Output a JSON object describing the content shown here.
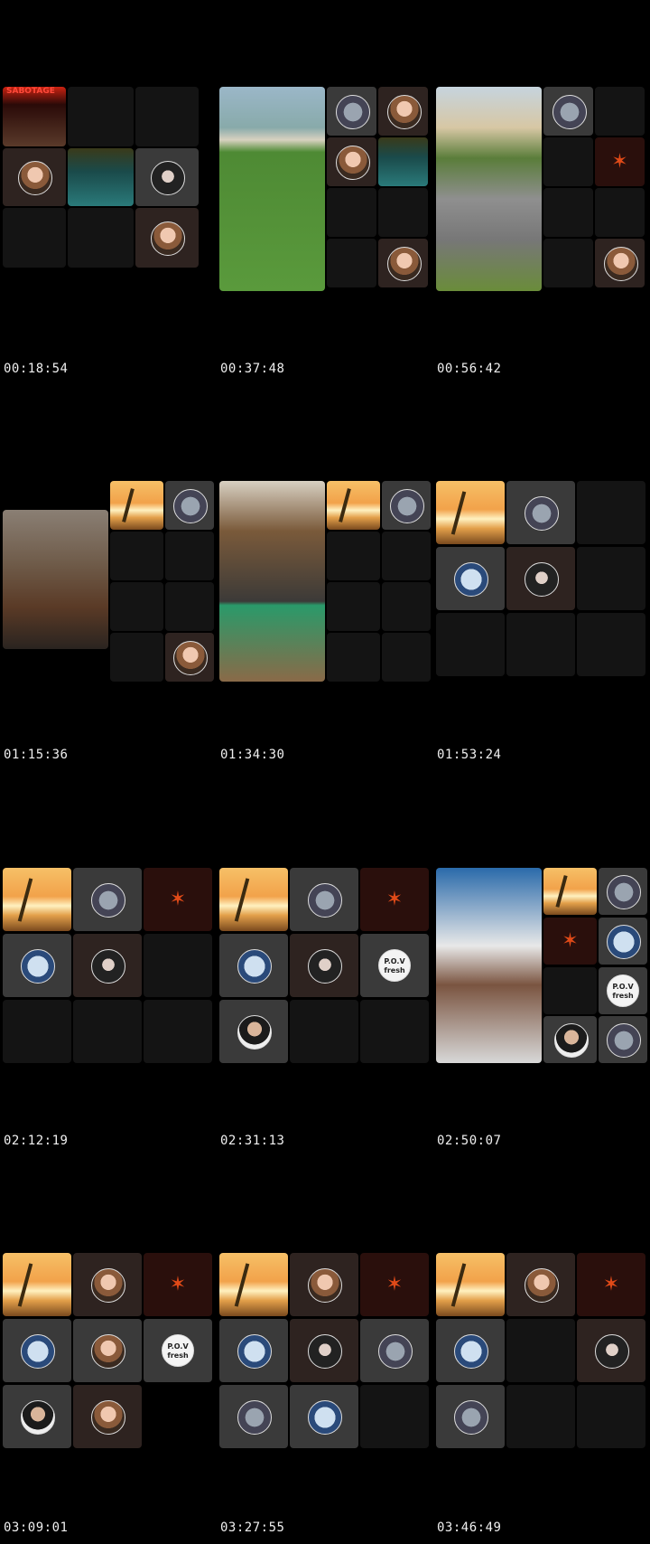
{
  "timestamps": [
    "00:18:54",
    "00:37:48",
    "00:56:42",
    "01:15:36",
    "01:34:30",
    "01:53:24",
    "02:12:19",
    "02:31:13",
    "02:50:07",
    "03:09:01",
    "03:27:55",
    "03:46:49"
  ],
  "tile_labels": {
    "sabotage": "SABOTAGE",
    "pov": "P.O.V fresh"
  }
}
